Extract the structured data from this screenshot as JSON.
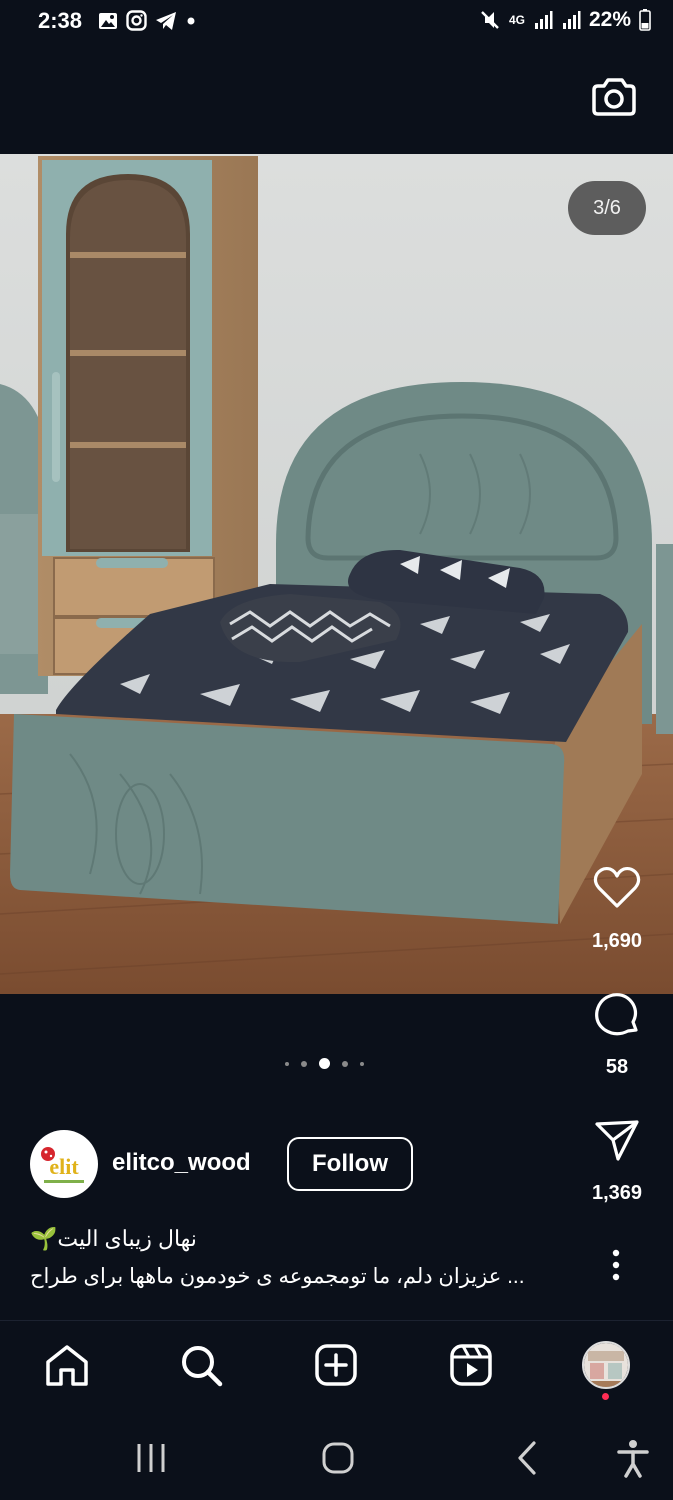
{
  "status_bar": {
    "time": "2:38",
    "network": "4G",
    "battery": "22%",
    "left_icons": [
      "gallery-icon",
      "instagram-icon",
      "telegram-icon",
      "dot-icon"
    ],
    "right_icons": [
      "mute-icon",
      "network-4g-icon",
      "signal-icon",
      "signal-icon",
      "battery-icon"
    ]
  },
  "header": {
    "camera_icon": "camera-icon"
  },
  "post": {
    "image_counter": "3/6",
    "carousel": {
      "count": 5,
      "active_index": 2
    },
    "likes": "1,690",
    "comments": "58",
    "shares": "1,369",
    "username": "elitco_wood",
    "follow_label": "Follow",
    "caption_title": "نهال زیبای الیت🌱",
    "caption_text": "عزیزان دلم، ما تومجموعه ی خودمون ماهها برای طراح ...",
    "avatar_text": "elit"
  },
  "bottom_nav": {
    "items": [
      "home-icon",
      "search-icon",
      "create-icon",
      "reels-icon",
      "profile-avatar"
    ]
  },
  "system_nav": {
    "items": [
      "recents-icon",
      "home-button-icon",
      "back-icon",
      "accessibility-icon"
    ]
  },
  "colors": {
    "background": "#0b101a",
    "bed_green": "#6f8a86",
    "floor": "#8a5a3a",
    "notification": "#ff2d55"
  }
}
